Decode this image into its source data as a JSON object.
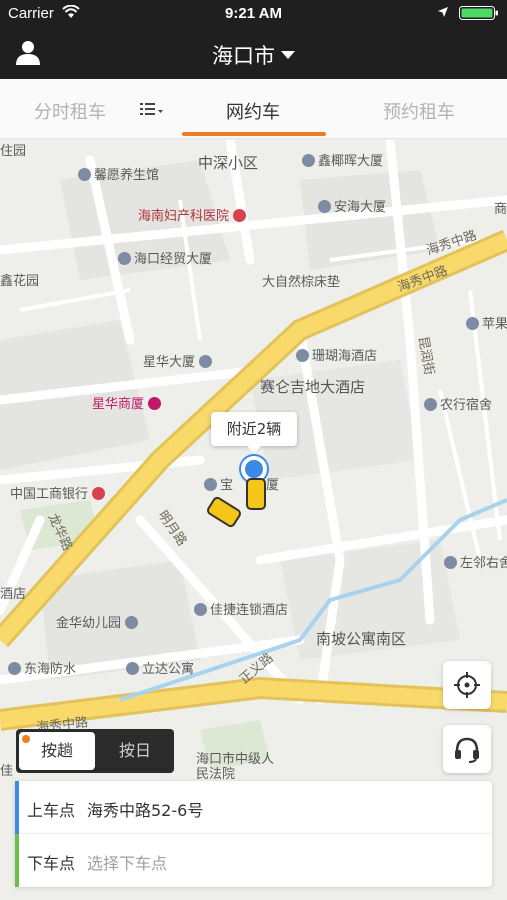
{
  "status_bar": {
    "carrier": "Carrier",
    "time": "9:21 AM"
  },
  "nav": {
    "city": "海口市",
    "user_icon": "user-icon",
    "dropdown_icon": "caret-down-icon"
  },
  "tabs": [
    {
      "label": "分时租车",
      "active": false
    },
    {
      "label": "网约车",
      "active": true
    },
    {
      "label": "预约租车",
      "active": false
    }
  ],
  "tab_menu_icon": "list-menu-icon",
  "accent_color": "#f07c22",
  "map": {
    "labels": [
      "住园",
      "馨愿养生馆",
      "中深小区",
      "鑫椰晖大厦",
      "海南妇产科医院",
      "安海大厦",
      "海口经贸大厦",
      "海秀中路",
      "鑫花园",
      "大自然棕床垫",
      "海秀中路",
      "苹果",
      "昆润街",
      "星华大厦",
      "珊瑚海酒店",
      "赛仑吉地大酒店",
      "星华商厦",
      "农行宿舍",
      "中国工商银行",
      "宝",
      "厦",
      "明月路",
      "龙华路",
      "左邻右舍",
      "酒店",
      "佳捷连锁酒店",
      "金华幼儿园",
      "南坡公寓南区",
      "东海防水",
      "立达公寓",
      "正义路",
      "海口市中级人民法院",
      "海秀中路",
      "佳",
      "商"
    ],
    "nearby_bubble": "附近2辆",
    "current_location_icon": "location-pin-icon",
    "car_icon": "taxi-icon"
  },
  "controls": {
    "locate_icon": "crosshair-icon",
    "service_icon": "headset-icon"
  },
  "toggle": {
    "option_active": "按趟",
    "option_inactive": "按日"
  },
  "trip": {
    "pickup_label": "上车点",
    "pickup_value": "海秀中路52-6号",
    "dropoff_label": "下车点",
    "dropoff_placeholder": "选择下车点"
  }
}
